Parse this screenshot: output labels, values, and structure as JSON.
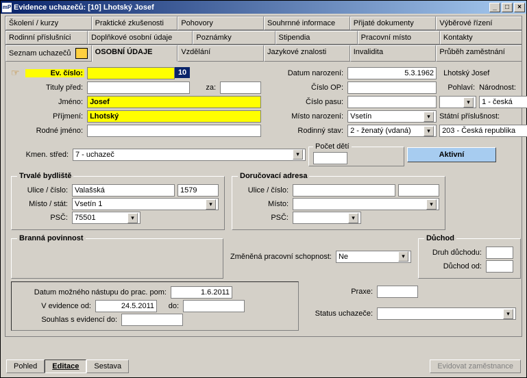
{
  "window": {
    "title": "Evidence uchazečů: [10] Lhotský Josef"
  },
  "tabs1": [
    "Školení / kurzy",
    "Praktické zkušenosti",
    "Pohovory",
    "Souhrnné informace",
    "Přijaté dokumenty",
    "Výběrové řízení"
  ],
  "tabs2": [
    "Rodinní příslušníci",
    "Doplňkové osobní údaje",
    "Poznámky",
    "Stipendia",
    "Pracovní místo",
    "Kontakty"
  ],
  "tabs3": [
    "Seznam uchazečů",
    "OSOBNÍ ÚDAJE",
    "Vzdělání",
    "Jazykové znalosti",
    "Invalidita",
    "Průběh zaměstnání"
  ],
  "activeTab": "OSOBNÍ ÚDAJE",
  "fields": {
    "ev_label": "Ev. číslo:",
    "ev_value": "10",
    "titul_pred": "Tituly před:",
    "titul_za": "za:",
    "jmeno_l": "Jméno:",
    "jmeno": "Josef",
    "prijmeni_l": "Příjmení:",
    "prijmeni": "Lhotský",
    "rodne_l": "Rodné jméno:",
    "datum_nar_l": "Datum narození:",
    "datum_nar": "5.3.1962",
    "name_display": "Lhotský Josef",
    "cop_l": "Číslo OP:",
    "cpas_l": "Číslo pasu:",
    "misto_nar_l": "Místo narození:",
    "misto_nar": "Vsetín",
    "rod_stav_l": "Rodinný stav:",
    "rod_stav": "2 - ženatý (vdaná)",
    "pohlavi_l": "Pohlaví:",
    "narodnost_l": "Národnost:",
    "narodnost": "1 - česká",
    "statpr_l": "Státní příslušnost:",
    "statpr": "203 - Česká republika",
    "kmen_l": "Kmen. střed:",
    "kmen": "7 - uchazeč",
    "pocet_deti_l": "Počet dětí",
    "status_btn": "Aktivní"
  },
  "addr": {
    "perm_title": "Trvalé bydliště",
    "deliv_title": "Doručovací adresa",
    "ulice_l": "Ulice / číslo:",
    "misto_l": "Místo / stát:",
    "misto2_l": "Místo:",
    "psc_l": "PSČ:",
    "ulice": "Valašská",
    "cislo": "1579",
    "misto": "Vsetín 1",
    "psc": "75501"
  },
  "branna": {
    "title": "Branná povinnost",
    "zps_l": "Změněná pracovní schopnost:",
    "zps": "Ne",
    "druh_l": "Důchod",
    "druhd_l": "Druh důchodu:",
    "duchod_od_l": "Důchod od:"
  },
  "dates": {
    "nastup_l": "Datum možného nástupu do prac. pom:",
    "nastup": "1.6.2011",
    "evod_l": "V evidence od:",
    "evod": "24.5.2011",
    "evdo_l": "do:",
    "souhlas_l": "Souhlas s evidencí do:",
    "praxe_l": "Praxe:",
    "status_l": "Status uchazeče:"
  },
  "footer": {
    "pohled": "Pohled",
    "editace": "Editace",
    "sestava": "Sestava",
    "zam": "Evidovat zaměstnance"
  }
}
